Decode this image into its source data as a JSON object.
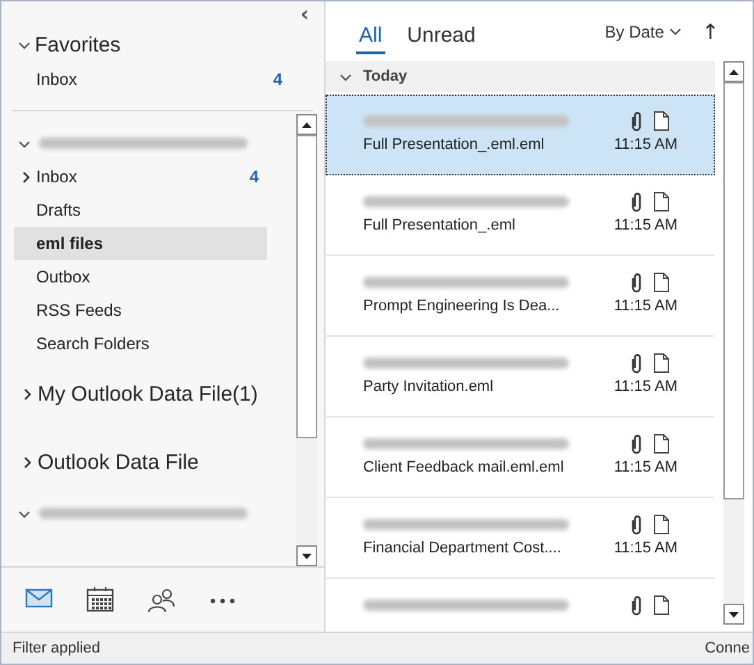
{
  "folder_pane": {
    "collapse_glyph": "‹",
    "favorites": {
      "title": "Favorites",
      "expanded": true,
      "items": [
        {
          "label": "Inbox",
          "count": "4",
          "selected": false
        }
      ]
    },
    "accounts": [
      {
        "kind": "account",
        "expanded": true,
        "folders": [
          {
            "label": "Inbox",
            "count": "4",
            "collapsed": true,
            "selected": false
          },
          {
            "label": "Drafts",
            "collapsed": false,
            "selected": false
          },
          {
            "label": "eml files",
            "collapsed": false,
            "selected": true
          },
          {
            "label": "Outbox",
            "collapsed": false,
            "selected": false
          },
          {
            "label": "RSS Feeds",
            "collapsed": false,
            "selected": false
          },
          {
            "label": "Search Folders",
            "collapsed": false,
            "selected": false
          }
        ]
      },
      {
        "kind": "datafile",
        "title": "My Outlook Data File(1)",
        "expanded": false
      },
      {
        "kind": "datafile",
        "title": "Outlook Data File",
        "expanded": false
      },
      {
        "kind": "account",
        "expanded": true
      }
    ]
  },
  "navigation": [
    {
      "kind": "mail",
      "selected": true
    },
    {
      "kind": "calendar",
      "selected": false
    },
    {
      "kind": "people",
      "selected": false
    },
    {
      "kind": "more",
      "selected": false
    }
  ],
  "message_list": {
    "tabs": [
      {
        "label": "All",
        "selected": true
      },
      {
        "label": "Unread",
        "selected": false
      }
    ],
    "sort": {
      "label": "By Date",
      "direction_glyph": "↑"
    },
    "group": {
      "label": "Today",
      "expanded": true
    },
    "messages": [
      {
        "subject": "Full Presentation_.eml.eml",
        "time": "11:15 AM",
        "attachment": true,
        "selected": true
      },
      {
        "subject": "Full Presentation_.eml",
        "time": "11:15 AM",
        "attachment": true,
        "selected": false
      },
      {
        "subject": "Prompt Engineering Is Dea...",
        "time": "11:15 AM",
        "attachment": true,
        "selected": false
      },
      {
        "subject": "Party Invitation.eml",
        "time": "11:15 AM",
        "attachment": true,
        "selected": false
      },
      {
        "subject": "Client Feedback mail.eml.eml",
        "time": "11:15 AM",
        "attachment": true,
        "selected": false
      },
      {
        "subject": "Financial Department Cost....",
        "time": "11:15 AM",
        "attachment": true,
        "selected": false
      },
      {
        "attachment": true,
        "selected": false
      }
    ]
  },
  "status_bar": {
    "left": "Filter applied",
    "right": "Conne"
  }
}
